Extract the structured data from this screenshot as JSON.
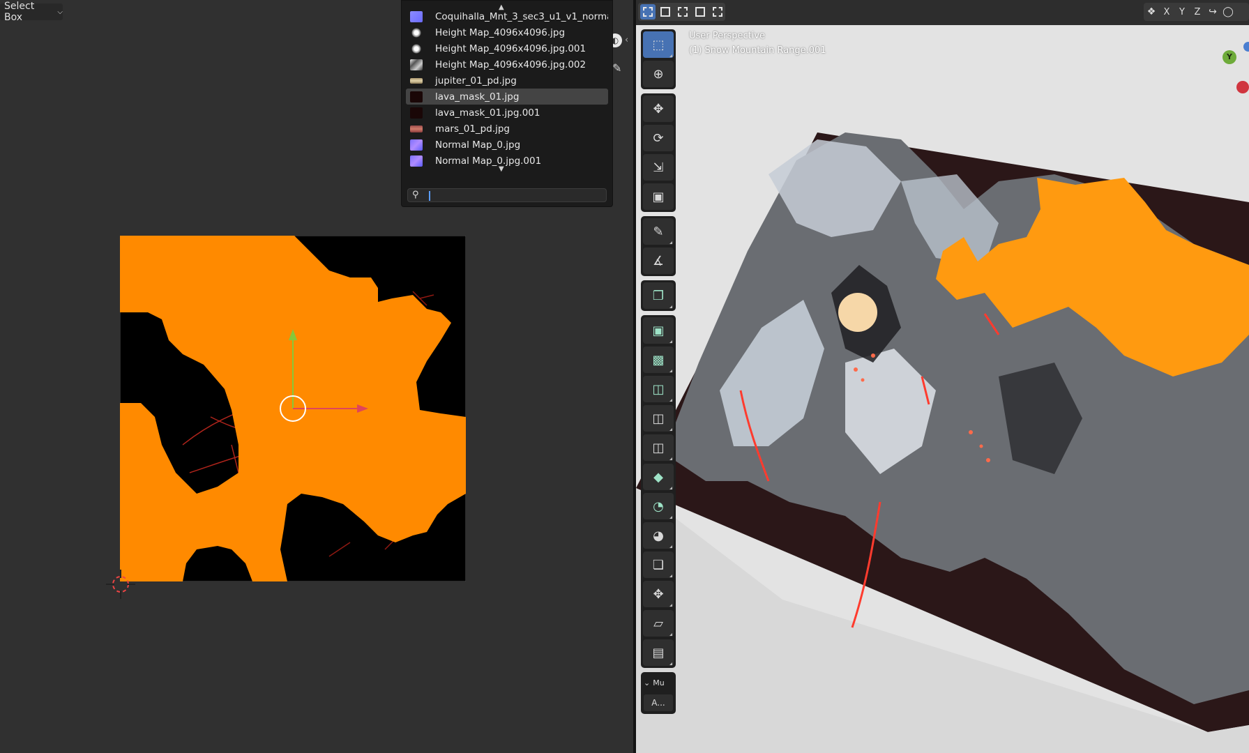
{
  "uv_editor": {
    "select_mode": "Select Box"
  },
  "image_browser": {
    "items": [
      {
        "name": "Coquihalla_Mnt_3_sec3_u1_v1_norma...",
        "thumb": "normal"
      },
      {
        "name": "Height Map_4096x4096.jpg",
        "thumb": "height"
      },
      {
        "name": "Height Map_4096x4096.jpg.001",
        "thumb": "height"
      },
      {
        "name": "Height Map_4096x4096.jpg.002",
        "thumb": "height2"
      },
      {
        "name": "jupiter_01_pd.jpg",
        "thumb": "jupiter"
      },
      {
        "name": "lava_mask_01.jpg",
        "thumb": "lava",
        "selected": true
      },
      {
        "name": "lava_mask_01.jpg.001",
        "thumb": "lava"
      },
      {
        "name": "mars_01_pd.jpg",
        "thumb": "mars"
      },
      {
        "name": "Normal Map_0.jpg",
        "thumb": "nm"
      },
      {
        "name": "Normal Map_0.jpg.001",
        "thumb": "nm"
      }
    ],
    "search_value": ""
  },
  "viewport": {
    "perspective_label": "User Perspective",
    "object_label": "(1) Snow Mountain Range.001",
    "axis_lock": [
      "X",
      "Y",
      "Z"
    ],
    "gizmo_y": "Y",
    "panel_title": "Mu",
    "panel_button": "A..."
  },
  "colors": {
    "selection_orange": "#ff8a00",
    "active_blue": "#4772b3",
    "lava_red": "#ff3b2e"
  },
  "icons": {
    "toolbar": [
      "select-box-icon",
      "cursor-icon",
      "move-icon",
      "rotate-icon",
      "scale-icon",
      "transform-icon",
      "annotate-icon",
      "measure-icon",
      "add-cube-icon",
      "extrude-region-icon",
      "inset-faces-icon",
      "bevel-icon",
      "loop-cut-icon",
      "knife-icon",
      "poly-build-icon",
      "spin-icon",
      "smooth-icon",
      "edge-slide-icon",
      "shrink-fatten-icon",
      "shear-icon",
      "rip-region-icon"
    ]
  }
}
